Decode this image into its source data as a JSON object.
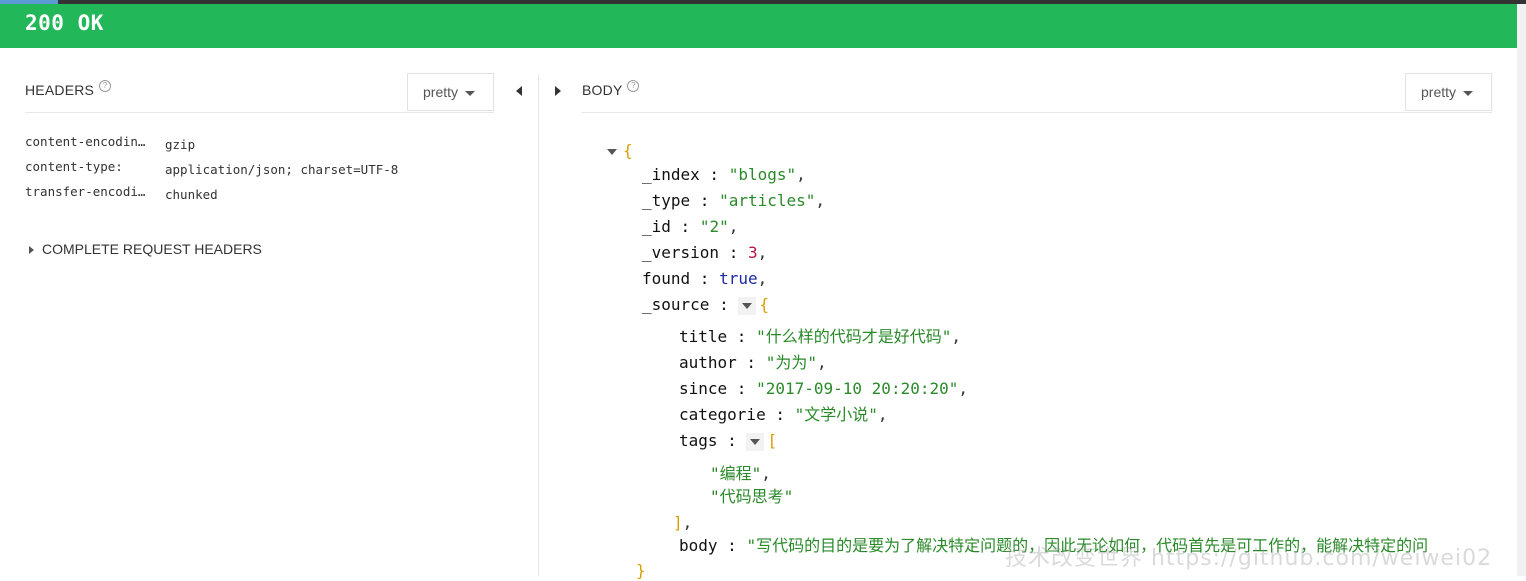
{
  "status": {
    "text": "200 OK",
    "color": "#22b85a"
  },
  "headers_panel": {
    "title": "HEADERS",
    "help_icon": "help-circle-icon",
    "format_dropdown": "pretty",
    "rows": [
      {
        "key": "content-encodin…",
        "value": "gzip"
      },
      {
        "key": "content-type:",
        "value": "application/json; charset=UTF-8"
      },
      {
        "key": "transfer-encodi…",
        "value": "chunked"
      }
    ],
    "complete_request_label": "COMPLETE REQUEST HEADERS"
  },
  "body_panel": {
    "title": "BODY",
    "help_icon": "help-circle-icon",
    "format_dropdown": "pretty",
    "json": {
      "open_brace": "{",
      "index_key": "_index",
      "index_val": "\"blogs\"",
      "type_key": "_type",
      "type_val": "\"articles\"",
      "id_key": "_id",
      "id_val": "\"2\"",
      "version_key": "_version",
      "version_val": "3",
      "found_key": "found",
      "found_val": "true",
      "source_key": "_source",
      "source_open": "{",
      "title_key": "title",
      "title_val": "\"什么样的代码才是好代码\"",
      "author_key": "author",
      "author_val": "\"为为\"",
      "since_key": "since",
      "since_val": "\"2017-09-10 20:20:20\"",
      "categorie_key": "categorie",
      "categorie_val": "\"文学小说\"",
      "tags_key": "tags",
      "tags_open": "[",
      "tag_1": "\"编程\"",
      "tag_2": "\"代码思考\"",
      "tags_close": "]",
      "body_key": "body",
      "body_val": "\"写代码的目的是要为了解决特定问题的，因此无论如何，代码首先是可工作的，能解决特定的问",
      "close_brace": "}"
    }
  },
  "watermark": "技术改变世界 https://github.com/weiwei02"
}
